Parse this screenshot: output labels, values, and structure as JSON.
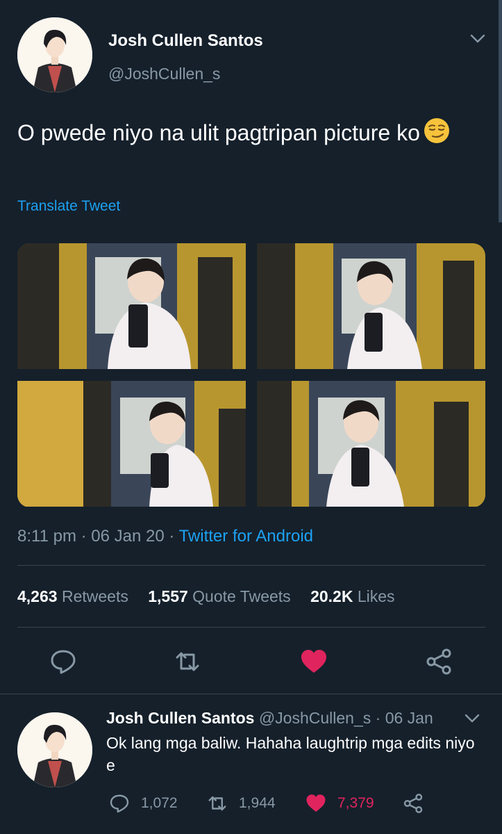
{
  "tweet": {
    "author_name": "Josh Cullen Santos",
    "author_handle": "@JoshCullen_s",
    "text": "O pwede niyo na ulit pagtripan picture ko",
    "emoji": "smirking-face",
    "translate_label": "Translate Tweet",
    "time": "8:11 pm",
    "date": "06 Jan 20",
    "source": "Twitter for Android",
    "separator": " · ",
    "stats": {
      "retweets_count": "4,263",
      "retweets_label": "Retweets",
      "quotes_count": "1,557",
      "quotes_label": "Quote Tweets",
      "likes_count": "20.2K",
      "likes_label": "Likes"
    },
    "actions": [
      "reply-icon",
      "retweet-icon",
      "like-icon",
      "share-icon"
    ],
    "liked": true
  },
  "reply": {
    "author_name": "Josh Cullen Santos",
    "author_handle": "@JoshCullen_s",
    "date": "· 06 Jan",
    "text": "Ok lang mga baliw. Hahaha laughtrip mga edits niyo e",
    "reply_count": "1,072",
    "retweet_count": "1,944",
    "like_count": "7,379",
    "liked": true
  },
  "colors": {
    "background": "#15202b",
    "text": "#ffffff",
    "secondary": "#8899a6",
    "link": "#1da1f2",
    "like": "#e0245e",
    "divider": "#38444d"
  }
}
